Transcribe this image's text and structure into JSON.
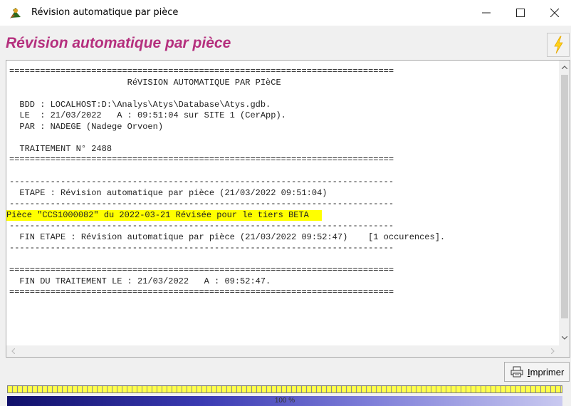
{
  "window": {
    "title": "Révision automatique par pièce"
  },
  "header": {
    "title": "Révision automatique par pièce",
    "title_color": "#b5307e"
  },
  "report": {
    "lines": [
      "===========================================================================",
      "                       RéVISION AUTOMATIQUE PAR PIèCE",
      "",
      "  BDD : LOCALHOST:D:\\Analys\\Atys\\Database\\Atys.gdb.",
      "  LE  : 21/03/2022   A : 09:51:04 sur SITE 1 (CerApp).",
      "  PAR : NADEGE (Nadege Orvoen)",
      "",
      "  TRAITEMENT N° 2488",
      "===========================================================================",
      "",
      "---------------------------------------------------------------------------",
      "  ETAPE : Révision automatique par pièce (21/03/2022 09:51:04)",
      "---------------------------------------------------------------------------",
      "Pièce \"CCS1000082\" du 2022-03-21 Révisée pour le tiers BETA",
      "---------------------------------------------------------------------------",
      "  FIN ETAPE : Révision automatique par pièce (21/03/2022 09:52:47)    [1 occurences].",
      "---------------------------------------------------------------------------",
      "",
      "===========================================================================",
      "  FIN DU TRAITEMENT LE : 21/03/2022   A : 09:52:47.",
      "==========================================================================="
    ],
    "highlight_color": "#ffff00"
  },
  "buttons": {
    "print_label_first": "I",
    "print_label_rest": "mprimer"
  },
  "progress": {
    "percent_text": "100 %",
    "value": 100
  }
}
